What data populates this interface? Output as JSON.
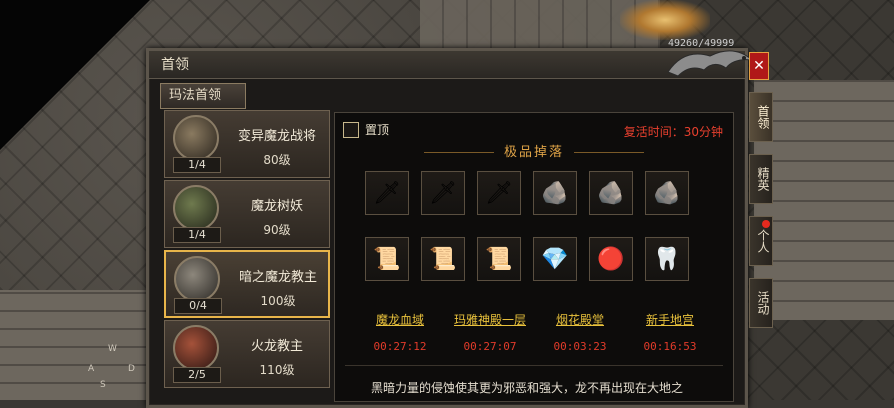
{
  "window": {
    "title": "首领",
    "hp_text": "49260/49999",
    "close_label": "✕"
  },
  "subtab": {
    "label": "玛法首领"
  },
  "bosses": [
    {
      "name": "变异魔龙战将",
      "level": "80级",
      "count": "1/4",
      "selected": false
    },
    {
      "name": "魔龙树妖",
      "level": "90级",
      "count": "1/4",
      "selected": false
    },
    {
      "name": "暗之魔龙教主",
      "level": "100级",
      "count": "0/4",
      "selected": true
    },
    {
      "name": "火龙教主",
      "level": "110级",
      "count": "2/5",
      "selected": false
    }
  ],
  "panel": {
    "pin_label": "置顶",
    "respawn": "复活时间：30分钟",
    "drops_title": "极品掉落",
    "items": [
      {
        "icon": "sword-icon",
        "glyph": "🗡"
      },
      {
        "icon": "sword-icon",
        "glyph": "🗡"
      },
      {
        "icon": "sword-icon",
        "glyph": "🗡"
      },
      {
        "icon": "ore-icon",
        "glyph": "🪨"
      },
      {
        "icon": "ore-icon",
        "glyph": "🪨"
      },
      {
        "icon": "ore-icon",
        "glyph": "🪨"
      },
      {
        "icon": "scroll-icon",
        "glyph": "📜"
      },
      {
        "icon": "scroll-icon",
        "glyph": "📜"
      },
      {
        "icon": "scroll-icon",
        "glyph": "📜"
      },
      {
        "icon": "purple-gem-icon",
        "glyph": "💎"
      },
      {
        "icon": "red-gem-icon",
        "glyph": "🔴"
      },
      {
        "icon": "crystal-icon",
        "glyph": "🦷"
      }
    ],
    "locations": [
      {
        "name": "魔龙血域",
        "time": "00:27:12"
      },
      {
        "name": "玛雅神殿一层",
        "time": "00:27:07"
      },
      {
        "name": "烟花殿堂",
        "time": "00:03:23"
      },
      {
        "name": "新手地宫",
        "time": "00:16:53"
      }
    ],
    "description": "黑暗力量的侵蚀使其更为邪恶和强大，龙不再出现在大地之"
  },
  "side_tabs": [
    {
      "label": "首领",
      "active": true
    },
    {
      "label": "精英",
      "active": false
    },
    {
      "label": "个人",
      "active": false
    },
    {
      "label": "活动",
      "active": false
    }
  ],
  "keys": [
    "W",
    "A",
    "S",
    "D"
  ]
}
